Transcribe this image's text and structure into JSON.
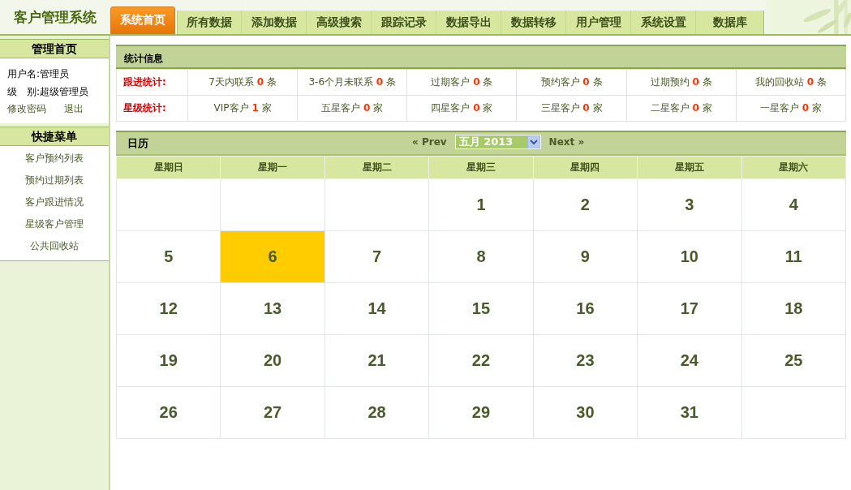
{
  "logo": "客户管理系统",
  "tabs": [
    {
      "label": "系统首页",
      "selected": true
    },
    {
      "label": "所有数据",
      "selected": false
    },
    {
      "label": "添加数据",
      "selected": false
    },
    {
      "label": "高级搜索",
      "selected": false
    },
    {
      "label": "跟踪记录",
      "selected": false
    },
    {
      "label": "数据导出",
      "selected": false
    },
    {
      "label": "数据转移",
      "selected": false
    },
    {
      "label": "用户管理",
      "selected": false
    },
    {
      "label": "系统设置",
      "selected": false
    },
    {
      "label": "数据库",
      "selected": false
    }
  ],
  "sidebar": {
    "home_title": "管理首页",
    "user_fields": [
      {
        "label": "用户名:",
        "value": "管理员"
      },
      {
        "label": "级　别:",
        "value": "超级管理员"
      }
    ],
    "links": [
      "修改密码",
      "退出"
    ],
    "menu_title": "快捷菜单",
    "menu_items": [
      "客户预约列表",
      "预约过期列表",
      "客户跟进情况",
      "星级客户管理",
      "公共回收站"
    ]
  },
  "stats": {
    "title": "统计信息",
    "rows": [
      {
        "label": "跟进统计:",
        "cells": [
          {
            "label": "7天内联系",
            "count": "0",
            "unit": "条"
          },
          {
            "label": "3-6个月未联系",
            "count": "0",
            "unit": "条"
          },
          {
            "label": "过期客户",
            "count": "0",
            "unit": "条"
          },
          {
            "label": "预约客户",
            "count": "0",
            "unit": "条"
          },
          {
            "label": "过期预约",
            "count": "0",
            "unit": "条"
          },
          {
            "label": "我的回收站",
            "count": "0",
            "unit": "条"
          }
        ]
      },
      {
        "label": "星级统计:",
        "cells": [
          {
            "label": "VIP客户",
            "count": "1",
            "unit": "家"
          },
          {
            "label": "五星客户",
            "count": "0",
            "unit": "家"
          },
          {
            "label": "四星客户",
            "count": "0",
            "unit": "家"
          },
          {
            "label": "三星客户",
            "count": "0",
            "unit": "家"
          },
          {
            "label": "二星客户",
            "count": "0",
            "unit": "家"
          },
          {
            "label": "一星客户",
            "count": "0",
            "unit": "家"
          }
        ]
      }
    ]
  },
  "calendar": {
    "title": "日历",
    "prev": "« Prev",
    "month": "五月 2013",
    "next": "Next »",
    "weekdays": [
      "星期日",
      "星期一",
      "星期二",
      "星期三",
      "星期四",
      "星期五",
      "星期六"
    ],
    "weeks": [
      [
        {
          "kind": "blank"
        },
        {
          "kind": "blank"
        },
        {
          "kind": "blank"
        },
        {
          "kind": "day",
          "day": "1",
          "selected": false
        },
        {
          "kind": "day",
          "day": "2",
          "selected": false
        },
        {
          "kind": "day",
          "day": "3",
          "selected": false
        },
        {
          "kind": "day",
          "day": "4",
          "selected": false
        }
      ],
      [
        {
          "kind": "day",
          "day": "5",
          "selected": false
        },
        {
          "kind": "day",
          "day": "6",
          "selected": true
        },
        {
          "kind": "day",
          "day": "7",
          "selected": false
        },
        {
          "kind": "day",
          "day": "8",
          "selected": false
        },
        {
          "kind": "day",
          "day": "9",
          "selected": false
        },
        {
          "kind": "day",
          "day": "10",
          "selected": false
        },
        {
          "kind": "day",
          "day": "11",
          "selected": false
        }
      ],
      [
        {
          "kind": "day",
          "day": "12",
          "selected": false
        },
        {
          "kind": "day",
          "day": "13",
          "selected": false
        },
        {
          "kind": "day",
          "day": "14",
          "selected": false
        },
        {
          "kind": "day",
          "day": "15",
          "selected": false
        },
        {
          "kind": "day",
          "day": "16",
          "selected": false
        },
        {
          "kind": "day",
          "day": "17",
          "selected": false
        },
        {
          "kind": "day",
          "day": "18",
          "selected": false
        }
      ],
      [
        {
          "kind": "day",
          "day": "19",
          "selected": false
        },
        {
          "kind": "day",
          "day": "20",
          "selected": false
        },
        {
          "kind": "day",
          "day": "21",
          "selected": false
        },
        {
          "kind": "day",
          "day": "22",
          "selected": false
        },
        {
          "kind": "day",
          "day": "23",
          "selected": false
        },
        {
          "kind": "day",
          "day": "24",
          "selected": false
        },
        {
          "kind": "day",
          "day": "25",
          "selected": false
        }
      ],
      [
        {
          "kind": "day",
          "day": "26",
          "selected": false
        },
        {
          "kind": "day",
          "day": "27",
          "selected": false
        },
        {
          "kind": "day",
          "day": "28",
          "selected": false
        },
        {
          "kind": "day",
          "day": "29",
          "selected": false
        },
        {
          "kind": "day",
          "day": "30",
          "selected": false
        },
        {
          "kind": "day",
          "day": "31",
          "selected": false
        },
        {
          "kind": "blank"
        }
      ]
    ]
  }
}
